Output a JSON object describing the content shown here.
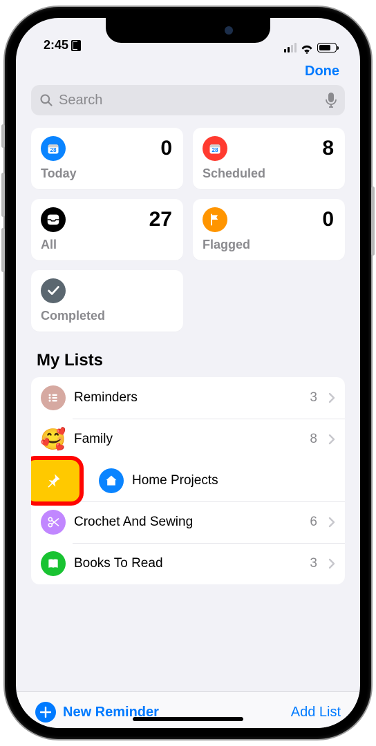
{
  "status": {
    "time": "2:45"
  },
  "nav": {
    "done": "Done"
  },
  "search": {
    "placeholder": "Search"
  },
  "smart": [
    {
      "key": "today",
      "label": "Today",
      "count": "0",
      "color": "#0a84ff",
      "icon": "calendar"
    },
    {
      "key": "scheduled",
      "label": "Scheduled",
      "count": "8",
      "color": "#ff3b30",
      "icon": "calendar"
    },
    {
      "key": "all",
      "label": "All",
      "count": "27",
      "color": "#000000",
      "icon": "inbox"
    },
    {
      "key": "flagged",
      "label": "Flagged",
      "count": "0",
      "color": "#ff9500",
      "icon": "flag"
    },
    {
      "key": "completed",
      "label": "Completed",
      "count": "",
      "color": "#5b6770",
      "icon": "check"
    }
  ],
  "section_title": "My Lists",
  "lists": [
    {
      "name": "Reminders",
      "count": "3",
      "color": "#d6a9a1",
      "icon": "list",
      "emoji": ""
    },
    {
      "name": "Family",
      "count": "8",
      "color": "#ffe0a8",
      "icon": "emoji",
      "emoji": "🥰"
    },
    {
      "name": "Home Projects",
      "count": "",
      "color": "#0a84ff",
      "icon": "house",
      "emoji": "",
      "swiped": true
    },
    {
      "name": "Crochet And Sewing",
      "count": "6",
      "color": "#c187ff",
      "icon": "scissors",
      "emoji": ""
    },
    {
      "name": "Books To Read",
      "count": "3",
      "color": "#19c332",
      "icon": "book",
      "emoji": ""
    }
  ],
  "swipe_action": {
    "label": "Pin",
    "icon": "pin"
  },
  "bottom": {
    "new_reminder": "New Reminder",
    "add_list": "Add List"
  }
}
